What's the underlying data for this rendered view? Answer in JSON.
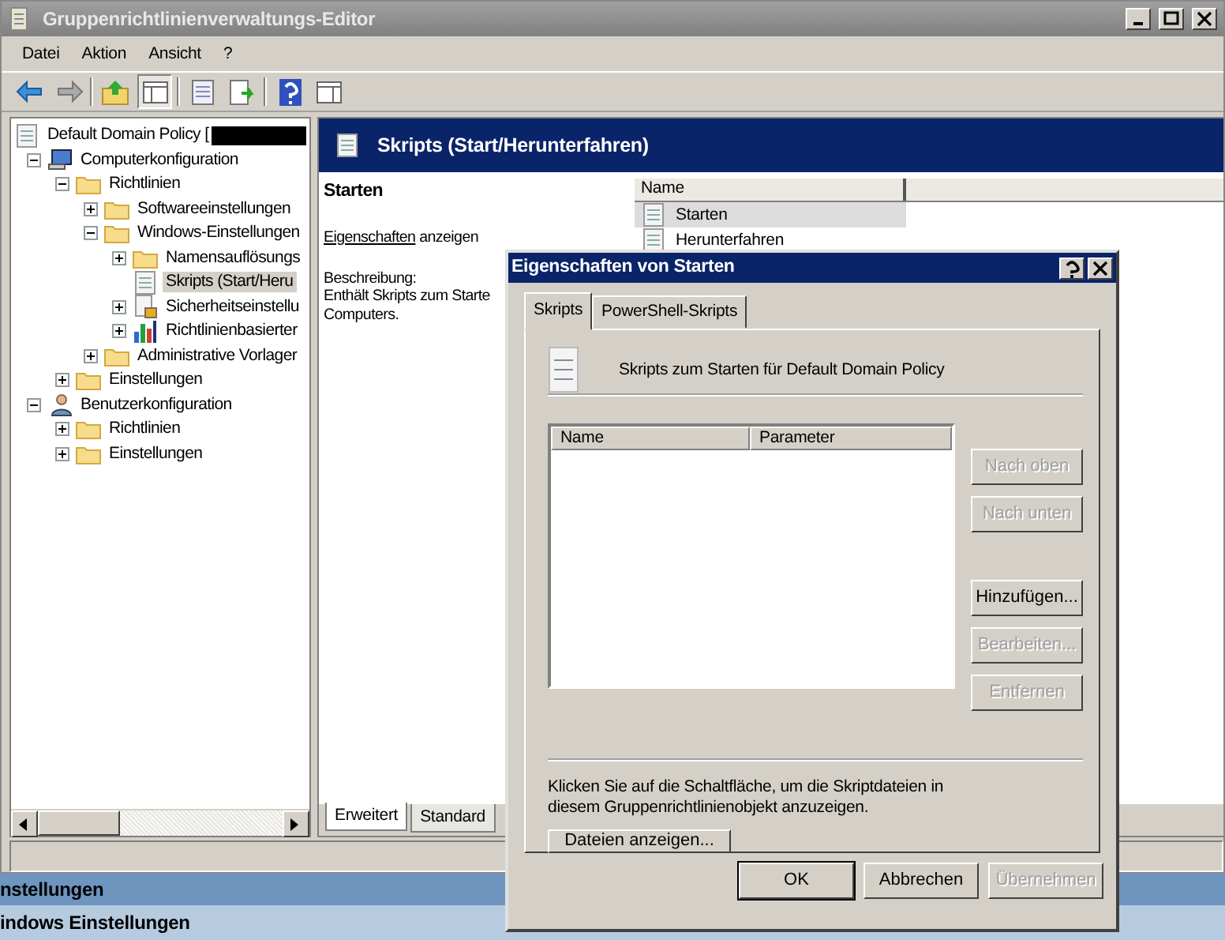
{
  "window": {
    "title": "Gruppenrichtlinienverwaltungs-Editor"
  },
  "menu": [
    "Datei",
    "Aktion",
    "Ansicht",
    "?"
  ],
  "toolbar": [
    {
      "kind": "back"
    },
    {
      "kind": "forward"
    },
    {
      "kind": "sep"
    },
    {
      "kind": "up"
    },
    {
      "kind": "tree",
      "selected": true
    },
    {
      "kind": "sep"
    },
    {
      "kind": "list",
      "selected": false
    },
    {
      "kind": "export",
      "selected": false
    },
    {
      "kind": "sep"
    },
    {
      "kind": "help",
      "selected": false
    },
    {
      "kind": "panel",
      "selected": false
    }
  ],
  "tree": {
    "root": "Default Domain Policy [",
    "items": [
      {
        "label": "Computerkonfiguration",
        "kind": "computer",
        "expanded": true,
        "selected": false,
        "children": [
          {
            "label": "Richtlinien",
            "kind": "folder",
            "expanded": true,
            "selected": false,
            "children": [
              {
                "label": "Softwareeinstellungen",
                "kind": "folder",
                "expanded": false,
                "selected": false
              },
              {
                "label": "Windows-Einstellungen",
                "kind": "folder",
                "expanded": true,
                "selected": false,
                "children": [
                  {
                    "label": "Namensauflösungs",
                    "kind": "folder",
                    "expanded": false,
                    "selected": false
                  },
                  {
                    "label": "Skripts (Start/Heru",
                    "kind": "script",
                    "selected": true
                  },
                  {
                    "label": "Sicherheitseinstellu",
                    "kind": "security",
                    "expanded": false,
                    "selected": false
                  },
                  {
                    "label": "Richtlinienbasierter",
                    "kind": "chart",
                    "expanded": false,
                    "selected": false
                  }
                ]
              },
              {
                "label": "Administrative Vorlager",
                "kind": "folder",
                "expanded": false,
                "selected": false
              }
            ]
          },
          {
            "label": "Einstellungen",
            "kind": "folder",
            "expanded": false,
            "selected": false
          }
        ]
      },
      {
        "label": "Benutzerkonfiguration",
        "kind": "user",
        "expanded": true,
        "selected": false,
        "children": [
          {
            "label": "Richtlinien",
            "kind": "folder",
            "expanded": false,
            "selected": false
          },
          {
            "label": "Einstellungen",
            "kind": "folder",
            "expanded": false,
            "selected": false
          }
        ]
      }
    ]
  },
  "detail": {
    "header": "Skripts (Start/Herunterfahren)",
    "heading": "Starten",
    "link": "Eigenschaften",
    "link_rest": "anzeigen",
    "description_label": "Beschreibung:",
    "description": [
      "Enthält Skripts zum Starte",
      "Computers."
    ],
    "list": {
      "column": "Name",
      "items": [
        {
          "label": "Starten",
          "selected": true
        },
        {
          "label": "Herunterfahren",
          "selected": false
        }
      ]
    },
    "tabs": [
      {
        "label": "Erweitert",
        "selected": true
      },
      {
        "label": "Standard",
        "selected": false
      }
    ]
  },
  "background": [
    "nstellungen",
    "indows Einstellungen"
  ],
  "dialog": {
    "title": "Eigenschaften von Starten",
    "tabs": [
      {
        "label": "Skripts",
        "selected": true
      },
      {
        "label": "PowerShell-Skripts",
        "selected": false
      }
    ],
    "heading": "Skripts zum Starten für Default Domain Policy",
    "columns": [
      "Name",
      "Parameter"
    ],
    "side_buttons": [
      {
        "label": "Nach oben",
        "disabled": true
      },
      {
        "label": "Nach unten",
        "disabled": true
      },
      {
        "label": "Hinzufügen...",
        "disabled": false
      },
      {
        "label": "Bearbeiten...",
        "disabled": true
      },
      {
        "label": "Entfernen",
        "disabled": true
      }
    ],
    "hint": "Klicken Sie auf die Schaltfläche, um die Skriptdateien in diesem Gruppenrichtlinienobjekt anzuzeigen.",
    "files_button": "Dateien anzeigen...",
    "footer": [
      {
        "label": "OK",
        "disabled": false,
        "default": true
      },
      {
        "label": "Abbrechen",
        "disabled": false,
        "default": false
      },
      {
        "label": "Übernehmen",
        "disabled": true,
        "default": false
      }
    ]
  }
}
